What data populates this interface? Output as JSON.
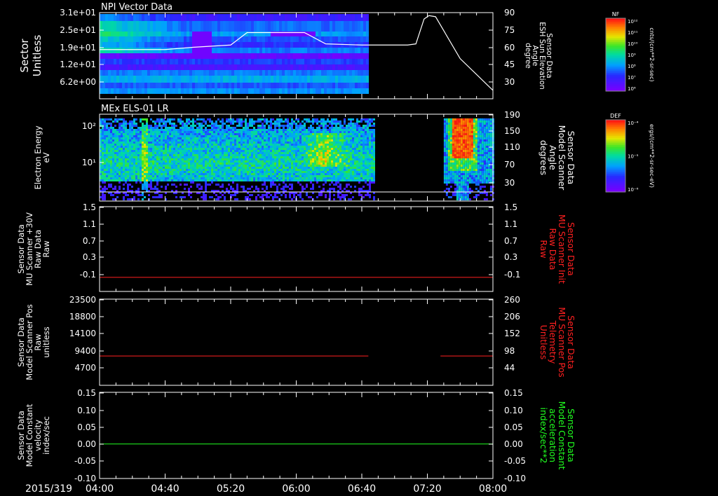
{
  "date_label": "2015/319",
  "x_ticks": [
    "04:00",
    "04:40",
    "05:20",
    "06:00",
    "06:40",
    "07:20",
    "08:00"
  ],
  "panels": [
    {
      "title": "NPI Vector Data",
      "left_ylabel": [
        "Sector",
        "Unitless"
      ],
      "left_ticks": [
        "3.1e+01",
        "2.5e+01",
        "1.9e+01",
        "1.2e+01",
        "6.2e+00"
      ],
      "right_ylabel": [
        "Sensor Data",
        "ESH Sun Elevation",
        "Angle",
        "degree"
      ],
      "right_ticks": [
        "90",
        "75",
        "60",
        "45",
        "30"
      ],
      "colorbar": {
        "tag": "NF",
        "unit": "cnts/(cm**2-sr-sec)",
        "ticks": [
          "10¹²",
          "10¹¹",
          "10¹⁰",
          "10⁹",
          "10⁸",
          "10⁷",
          "10⁶"
        ]
      }
    },
    {
      "title": "MEx ELS-01 LR",
      "left_ylabel": [
        "Electron Energy",
        "eV"
      ],
      "left_ticks": [
        "10²",
        "10¹"
      ],
      "right_ylabel": [
        "Sensor Data",
        "Model Scanner",
        "Angle",
        "degrees"
      ],
      "right_ticks": [
        "190",
        "150",
        "110",
        "70",
        "30"
      ],
      "colorbar": {
        "tag": "DEF",
        "unit": "ergs/(cm**2-sr-sec-eV)",
        "ticks": [
          "10⁻⁴",
          "10⁻⁵",
          "10⁻⁶"
        ]
      }
    },
    {
      "left_ylabel": [
        "Sensor Data",
        "MU Scanner +30V",
        "Raw Data",
        "Raw"
      ],
      "left_ticks": [
        "1.5",
        "1.1",
        "0.7",
        "0.3",
        "-0.1"
      ],
      "right_ylabel": [
        "Sensor Data",
        "MU Scanner Init",
        "Raw Data",
        "Raw"
      ],
      "right_ticks": [
        "1.5",
        "1.1",
        "0.7",
        "0.3",
        "-0.1"
      ]
    },
    {
      "left_ylabel": [
        "Sensor Data",
        "Model Scanner Pos",
        "Raw",
        "unitless"
      ],
      "left_ticks": [
        "23500",
        "18800",
        "14100",
        "9400",
        "4700"
      ],
      "right_ylabel": [
        "Sensor Data",
        "MU Scanner Pos",
        "Telemetry",
        "Unitless"
      ],
      "right_ticks": [
        "260",
        "206",
        "152",
        "98",
        "44"
      ]
    },
    {
      "left_ylabel": [
        "Sensor Data",
        "Model Constant",
        "velocity",
        "index/sec"
      ],
      "left_ticks": [
        "0.15",
        "0.10",
        "0.05",
        "0.00",
        "-0.05",
        "-0.10"
      ],
      "right_ylabel": [
        "Sensor Data",
        "Model Constant",
        "acceleration",
        "index/sec**2"
      ],
      "right_ticks": [
        "0.15",
        "0.10",
        "0.05",
        "0.00",
        "-0.05",
        "-0.10"
      ]
    }
  ],
  "colors": {
    "axis": "#ffffff",
    "red_trace": "#ff2020",
    "green_trace": "#20ff20",
    "right_label_red": "#ff2020",
    "right_label_green": "#20ff20"
  },
  "chart_data": [
    {
      "type": "heatmap",
      "title": "NPI Vector Data",
      "ylabel": "Sector Unitless",
      "y2label": "Sensor Data ESH Sun Elevation Angle degree",
      "x_range": [
        "04:00",
        "08:00"
      ],
      "data_end": "06:44",
      "sun_elevation_line": {
        "x": [
          "04:00",
          "04:40",
          "04:57",
          "05:20",
          "05:30",
          "05:47",
          "06:05",
          "06:18",
          "06:40",
          "07:08",
          "07:13",
          "07:18",
          "07:21",
          "07:25",
          "07:40",
          "08:00"
        ],
        "y": [
          58,
          58,
          60,
          62,
          73,
          73,
          73,
          63,
          62,
          62,
          63,
          85,
          88,
          87,
          50,
          22
        ]
      }
    },
    {
      "type": "heatmap",
      "title": "MEx ELS-01 LR",
      "ylabel": "Electron Energy eV",
      "y2label": "Sensor Data Model Scanner Angle degrees",
      "x_range": [
        "04:00",
        "08:00"
      ],
      "data_intervals": [
        [
          "04:00",
          "06:47"
        ],
        [
          "07:30",
          "08:00"
        ]
      ],
      "scanner_angle_line": {
        "x": [
          "04:00",
          "08:00"
        ],
        "y": [
          10,
          10
        ]
      }
    },
    {
      "type": "line",
      "ylabel": "Sensor Data MU Scanner +30V Raw Data Raw",
      "ylim": [
        -0.3,
        1.5
      ],
      "series": [
        {
          "x": [
            "04:00",
            "08:00"
          ],
          "y": [
            0.0,
            0.0
          ]
        }
      ]
    },
    {
      "type": "line",
      "ylabel": "Sensor Data Model Scanner Pos Raw unitless",
      "ylim": [
        0,
        23500
      ],
      "series": [
        {
          "x": [
            "04:00",
            "06:44"
          ],
          "y": [
            8000,
            8000
          ]
        },
        {
          "x": [
            "07:28",
            "08:00"
          ],
          "y": [
            8000,
            8000
          ]
        }
      ]
    },
    {
      "type": "line",
      "ylabel": "Sensor Data Model Constant velocity index/sec",
      "ylim": [
        -0.1,
        0.15
      ],
      "series": [
        {
          "x": [
            "04:00",
            "08:00"
          ],
          "y": [
            0.0,
            0.0
          ]
        }
      ]
    }
  ]
}
